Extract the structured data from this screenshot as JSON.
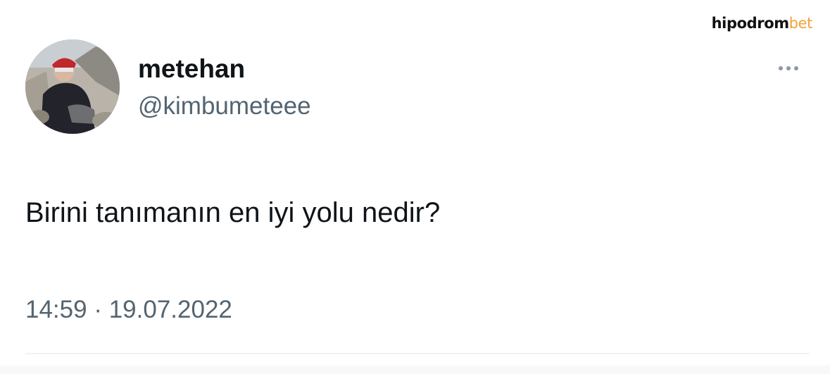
{
  "watermark": {
    "main": "hipodrom",
    "accent": "bet"
  },
  "tweet": {
    "display_name": "metehan",
    "handle": "@kimbumeteee",
    "text": "Birini tanımanın en iyi yolu nedir?",
    "time": "14:59",
    "separator": "·",
    "date": "19.07.2022"
  },
  "icons": {
    "avatar": "user-photo",
    "more": "more-horizontal-icon"
  },
  "colors": {
    "text_primary": "#0f1419",
    "text_secondary": "#536471",
    "accent": "#f2a33a"
  }
}
